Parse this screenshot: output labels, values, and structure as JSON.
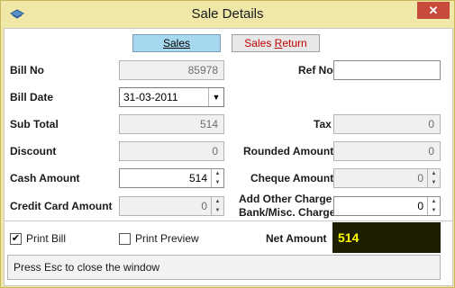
{
  "window": {
    "title": "Sale Details",
    "close_label": "✕"
  },
  "tabs": {
    "sales": "Sales",
    "sales_return_prefix": "Sales ",
    "sales_return_underlined": "R",
    "sales_return_suffix": "eturn"
  },
  "fields": {
    "bill_no": {
      "label": "Bill No",
      "value": "85978"
    },
    "ref_no": {
      "label": "Ref No",
      "value": ""
    },
    "bill_date": {
      "label": "Bill Date",
      "value": "31-03-2011"
    },
    "sub_total": {
      "label": "Sub Total",
      "value": "514"
    },
    "tax": {
      "label": "Tax",
      "value": "0"
    },
    "discount": {
      "label": "Discount",
      "value": "0"
    },
    "rounded_amount": {
      "label": "Rounded Amount",
      "value": "0"
    },
    "cash_amount": {
      "label": "Cash Amount",
      "value": "514"
    },
    "cheque_amount": {
      "label": "Cheque Amount",
      "value": "0"
    },
    "credit_card_amount": {
      "label": "Credit Card Amount",
      "value": "0"
    },
    "add_other_charge": {
      "label_line1": "Add Other Charge",
      "label_line2": "Bank/Misc. Charge",
      "value": "0"
    }
  },
  "options": {
    "print_bill": {
      "label": "Print Bill",
      "checked": true
    },
    "print_preview": {
      "label": "Print Preview",
      "checked": false
    }
  },
  "net_amount": {
    "label": "Net Amount",
    "value": "514"
  },
  "status": "Press Esc to close the window",
  "colors": {
    "window_bg": "#f0e8a8",
    "net_bg": "#1e1e00",
    "net_fg": "#ffff00",
    "close_bg": "#c74a3c"
  }
}
